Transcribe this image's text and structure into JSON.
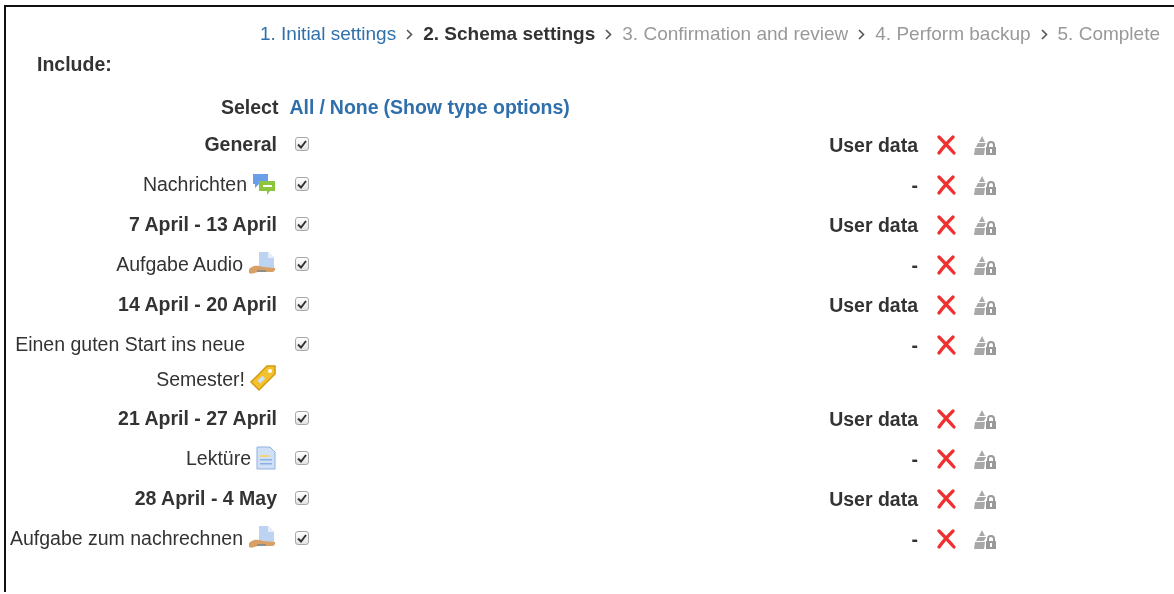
{
  "breadcrumb": [
    {
      "label": "1. Initial settings",
      "kind": "done"
    },
    {
      "label": "2. Schema settings",
      "kind": "current"
    },
    {
      "label": "3. Confirmation and review",
      "kind": "upcoming"
    },
    {
      "label": "4. Perform backup",
      "kind": "upcoming"
    },
    {
      "label": "5. Complete",
      "kind": "upcoming"
    }
  ],
  "include_label": "Include:",
  "select": {
    "label": "Select",
    "all": "All",
    "separator": "/",
    "none": "None",
    "type_options": "(Show type options)"
  },
  "items": [
    {
      "kind": "section",
      "label": "General",
      "checked": true,
      "userdata": "User data"
    },
    {
      "kind": "forum",
      "label": "Nachrichten",
      "checked": true,
      "userdata": "-"
    },
    {
      "kind": "section",
      "label": "7 April - 13 April",
      "checked": true,
      "userdata": "User data"
    },
    {
      "kind": "assign",
      "label": "Aufgabe Audio",
      "checked": true,
      "userdata": "-"
    },
    {
      "kind": "section",
      "label": "14 April - 20 April",
      "checked": true,
      "userdata": "User data"
    },
    {
      "kind": "label",
      "label": "Einen guten Start ins neue Semester!",
      "checked": true,
      "userdata": "-"
    },
    {
      "kind": "section",
      "label": "21 April - 27 April",
      "checked": true,
      "userdata": "User data"
    },
    {
      "kind": "resource",
      "label": "Lektüre",
      "checked": true,
      "userdata": "-"
    },
    {
      "kind": "section",
      "label": "28 April - 4 May",
      "checked": true,
      "userdata": "User data"
    },
    {
      "kind": "assign",
      "label": "Aufgabe zum nachrechnen",
      "checked": true,
      "userdata": "-"
    }
  ]
}
